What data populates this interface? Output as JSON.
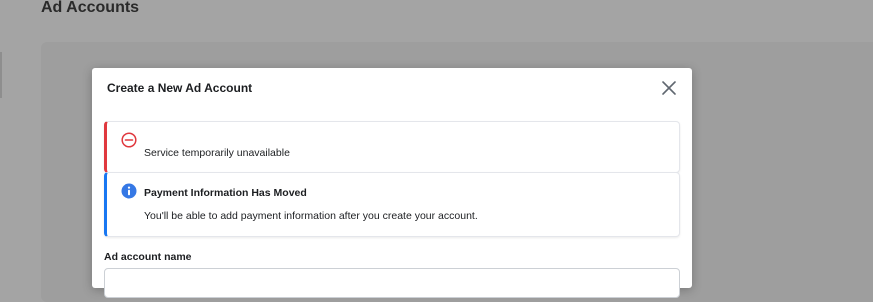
{
  "page": {
    "title": "Ad Accounts"
  },
  "modal": {
    "title": "Create a New Ad Account",
    "close_icon": "close-icon",
    "alerts": [
      {
        "type": "error",
        "icon": "error-circle-icon",
        "color": "#e0383e",
        "message": "Service temporarily unavailable"
      },
      {
        "type": "info",
        "icon": "info-icon",
        "color": "#1877f2",
        "heading": "Payment Information Has Moved",
        "message": "You'll be able to add payment information after you create your account."
      }
    ],
    "fields": {
      "ad_account_name": {
        "label": "Ad account name",
        "value": ""
      }
    }
  }
}
